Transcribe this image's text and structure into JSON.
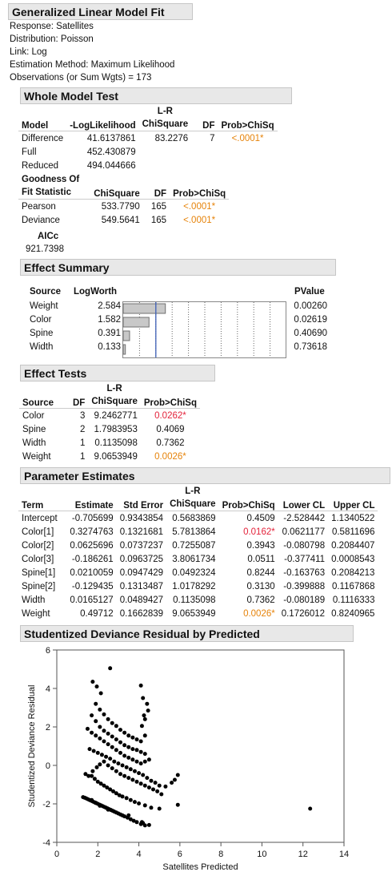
{
  "report": {
    "title": "Generalized Linear Model Fit",
    "info": [
      "Response: Satellites",
      "Distribution: Poisson",
      "Link: Log",
      "Estimation Method: Maximum Likelihood",
      "Observations (or Sum Wgts) = 173"
    ]
  },
  "whole_model": {
    "title": "Whole Model Test",
    "headers": [
      "Model",
      "-LogLikelihood",
      "L-R ChiSquare",
      "DF",
      "Prob>ChiSq"
    ],
    "header_top_lr": "L-R",
    "header_bot_lr": "ChiSquare",
    "rows": [
      {
        "model": "Difference",
        "ll": "41.6137861",
        "chisq": "83.2276",
        "df": "7",
        "p": "<.0001*"
      },
      {
        "model": "Full",
        "ll": "452.430879",
        "chisq": "",
        "df": "",
        "p": ""
      },
      {
        "model": "Reduced",
        "ll": "494.044666",
        "chisq": "",
        "df": "",
        "p": ""
      }
    ]
  },
  "goodness": {
    "h1_top": "Goodness Of",
    "h1_bot": "Fit Statistic",
    "h2": "ChiSquare",
    "h3": "DF",
    "h4": "Prob>ChiSq",
    "rows": [
      {
        "stat": "Pearson",
        "chisq": "533.7790",
        "df": "165",
        "p": "<.0001*"
      },
      {
        "stat": "Deviance",
        "chisq": "549.5641",
        "df": "165",
        "p": "<.0001*"
      }
    ],
    "aicc_label": "AICc",
    "aicc_value": "921.7398"
  },
  "effect_summary": {
    "title": "Effect Summary",
    "h_source": "Source",
    "h_logworth": "LogWorth",
    "h_pvalue": "PValue",
    "rows": [
      {
        "source": "Weight",
        "logworth": "2.584",
        "lw": 2.584,
        "pvalue": "0.00260"
      },
      {
        "source": "Color",
        "logworth": "1.582",
        "lw": 1.582,
        "pvalue": "0.02619"
      },
      {
        "source": "Spine",
        "logworth": "0.391",
        "lw": 0.391,
        "pvalue": "0.40690"
      },
      {
        "source": "Width",
        "logworth": "0.133",
        "lw": 0.133,
        "pvalue": "0.73618"
      }
    ]
  },
  "effect_tests": {
    "title": "Effect Tests",
    "h_source": "Source",
    "h_df": "DF",
    "h_lr_top": "L-R",
    "h_lr_bot": "ChiSquare",
    "h_p": "Prob>ChiSq",
    "rows": [
      {
        "source": "Color",
        "df": "3",
        "chisq": "9.2462771",
        "p": "0.0262*",
        "sig": "r"
      },
      {
        "source": "Spine",
        "df": "2",
        "chisq": "1.7983953",
        "p": "0.4069",
        "sig": ""
      },
      {
        "source": "Width",
        "df": "1",
        "chisq": "0.1135098",
        "p": "0.7362",
        "sig": ""
      },
      {
        "source": "Weight",
        "df": "1",
        "chisq": "9.0653949",
        "p": "0.0026*",
        "sig": "o"
      }
    ]
  },
  "param_estimates": {
    "title": "Parameter Estimates",
    "h_term": "Term",
    "h_est": "Estimate",
    "h_se": "Std Error",
    "h_lr_top": "L-R",
    "h_lr_bot": "ChiSquare",
    "h_p": "Prob>ChiSq",
    "h_lcl": "Lower CL",
    "h_ucl": "Upper CL",
    "rows": [
      {
        "term": "Intercept",
        "est": "-0.705699",
        "se": "0.9343854",
        "chisq": "0.5683869",
        "p": "0.4509",
        "lcl": "-2.528442",
        "ucl": "1.1340522",
        "sig": ""
      },
      {
        "term": "Color[1]",
        "est": "0.3274763",
        "se": "0.1321681",
        "chisq": "5.7813864",
        "p": "0.0162*",
        "lcl": "0.0621177",
        "ucl": "0.5811696",
        "sig": "r"
      },
      {
        "term": "Color[2]",
        "est": "0.0625696",
        "se": "0.0737237",
        "chisq": "0.7255087",
        "p": "0.3943",
        "lcl": "-0.080798",
        "ucl": "0.2084407",
        "sig": ""
      },
      {
        "term": "Color[3]",
        "est": "-0.186261",
        "se": "0.0963725",
        "chisq": "3.8061734",
        "p": "0.0511",
        "lcl": "-0.377411",
        "ucl": "0.0008543",
        "sig": ""
      },
      {
        "term": "Spine[1]",
        "est": "0.0210059",
        "se": "0.0947429",
        "chisq": "0.0492324",
        "p": "0.8244",
        "lcl": "-0.163763",
        "ucl": "0.2084213",
        "sig": ""
      },
      {
        "term": "Spine[2]",
        "est": "-0.129435",
        "se": "0.1313487",
        "chisq": "1.0178292",
        "p": "0.3130",
        "lcl": "-0.399888",
        "ucl": "0.1167868",
        "sig": ""
      },
      {
        "term": "Width",
        "est": "0.0165127",
        "se": "0.0489427",
        "chisq": "0.1135098",
        "p": "0.7362",
        "lcl": "-0.080189",
        "ucl": "0.1116333",
        "sig": ""
      },
      {
        "term": "Weight",
        "est": "0.49712",
        "se": "0.1662839",
        "chisq": "9.0653949",
        "p": "0.0026*",
        "lcl": "0.1726012",
        "ucl": "0.8240965",
        "sig": "o"
      }
    ]
  },
  "residual_plot": {
    "title": "Studentized Deviance Residual by Predicted"
  },
  "chart_data": {
    "type": "scatter",
    "title": "Studentized Deviance Residual by Predicted",
    "xlabel": "Satellites Predicted",
    "ylabel": "Studentized Deviance Residual",
    "xlim": [
      0,
      14
    ],
    "ylim": [
      -4,
      6
    ],
    "xticks": [
      "0",
      "2",
      "4",
      "6",
      "8",
      "10",
      "12",
      "14"
    ],
    "yticks": [
      "-4",
      "-2",
      "0",
      "2",
      "4",
      "6"
    ],
    "grid": false,
    "points": [
      [
        1.28,
        -1.65
      ],
      [
        1.36,
        -1.68
      ],
      [
        1.44,
        -1.72
      ],
      [
        1.52,
        -1.76
      ],
      [
        1.6,
        -1.8
      ],
      [
        1.68,
        -1.84
      ],
      [
        1.76,
        -1.88
      ],
      [
        1.84,
        -1.92
      ],
      [
        1.92,
        -1.96
      ],
      [
        2.0,
        -2.0
      ],
      [
        2.08,
        -2.04
      ],
      [
        2.16,
        -2.08
      ],
      [
        2.24,
        -2.12
      ],
      [
        2.32,
        -2.16
      ],
      [
        2.4,
        -2.2
      ],
      [
        2.48,
        -2.24
      ],
      [
        2.56,
        -2.28
      ],
      [
        2.64,
        -2.32
      ],
      [
        2.72,
        -2.36
      ],
      [
        2.8,
        -2.4
      ],
      [
        2.9,
        -2.45
      ],
      [
        3.0,
        -2.5
      ],
      [
        3.1,
        -2.55
      ],
      [
        3.2,
        -2.6
      ],
      [
        3.3,
        -2.65
      ],
      [
        3.45,
        -2.72
      ],
      [
        3.6,
        -2.8
      ],
      [
        3.75,
        -2.88
      ],
      [
        3.9,
        -2.95
      ],
      [
        4.1,
        -3.05
      ],
      [
        4.3,
        -3.12
      ],
      [
        4.5,
        -3.1
      ],
      [
        4.2,
        -3.0
      ],
      [
        3.5,
        -2.6
      ],
      [
        2.1,
        -2.1
      ],
      [
        1.9,
        -1.95
      ],
      [
        1.7,
        -1.8
      ],
      [
        2.5,
        -2.3
      ],
      [
        4.15,
        -2.95
      ],
      [
        1.7,
        -0.55
      ],
      [
        1.85,
        -0.7
      ],
      [
        2.0,
        -0.85
      ],
      [
        2.15,
        -0.95
      ],
      [
        2.3,
        -1.05
      ],
      [
        2.45,
        -1.15
      ],
      [
        2.6,
        -1.25
      ],
      [
        2.75,
        -1.35
      ],
      [
        2.9,
        -1.45
      ],
      [
        3.05,
        -1.55
      ],
      [
        3.2,
        -1.62
      ],
      [
        3.4,
        -1.7
      ],
      [
        3.6,
        -1.8
      ],
      [
        3.8,
        -1.9
      ],
      [
        4.0,
        -1.98
      ],
      [
        4.3,
        -2.08
      ],
      [
        4.6,
        -2.2
      ],
      [
        5.0,
        -2.25
      ],
      [
        5.9,
        -2.05
      ],
      [
        1.4,
        -0.45
      ],
      [
        1.55,
        -0.55
      ],
      [
        1.75,
        -0.3
      ],
      [
        1.95,
        -0.1
      ],
      [
        2.1,
        0.05
      ],
      [
        2.3,
        0.2
      ],
      [
        2.5,
        0.0
      ],
      [
        2.7,
        -0.15
      ],
      [
        2.9,
        -0.3
      ],
      [
        3.1,
        -0.45
      ],
      [
        3.3,
        -0.55
      ],
      [
        3.5,
        -0.65
      ],
      [
        3.7,
        -0.75
      ],
      [
        3.9,
        -0.85
      ],
      [
        4.1,
        -0.95
      ],
      [
        4.3,
        -1.05
      ],
      [
        4.5,
        -1.15
      ],
      [
        4.7,
        -1.25
      ],
      [
        4.9,
        -1.35
      ],
      [
        5.1,
        -1.5
      ],
      [
        1.6,
        0.85
      ],
      [
        1.8,
        0.75
      ],
      [
        2.0,
        0.65
      ],
      [
        2.2,
        0.55
      ],
      [
        2.4,
        0.45
      ],
      [
        2.6,
        0.35
      ],
      [
        2.8,
        0.2
      ],
      [
        3.0,
        0.1
      ],
      [
        3.2,
        0.0
      ],
      [
        3.4,
        -0.1
      ],
      [
        3.6,
        -0.2
      ],
      [
        3.8,
        -0.3
      ],
      [
        4.0,
        -0.4
      ],
      [
        4.2,
        -0.5
      ],
      [
        4.4,
        -0.65
      ],
      [
        4.6,
        -0.8
      ],
      [
        4.8,
        -0.9
      ],
      [
        5.0,
        -1.05
      ],
      [
        5.3,
        -1.1
      ],
      [
        5.6,
        -0.9
      ],
      [
        5.9,
        -0.5
      ],
      [
        5.75,
        -0.75
      ],
      [
        1.5,
        1.9
      ],
      [
        1.7,
        1.7
      ],
      [
        1.9,
        1.55
      ],
      [
        2.1,
        1.4
      ],
      [
        2.3,
        1.25
      ],
      [
        2.5,
        1.1
      ],
      [
        2.7,
        0.95
      ],
      [
        2.9,
        0.8
      ],
      [
        3.1,
        0.65
      ],
      [
        3.3,
        0.5
      ],
      [
        3.5,
        0.4
      ],
      [
        3.7,
        0.3
      ],
      [
        3.9,
        0.2
      ],
      [
        4.1,
        0.1
      ],
      [
        4.3,
        0.2
      ],
      [
        4.5,
        0.3
      ],
      [
        1.7,
        2.6
      ],
      [
        1.9,
        2.3
      ],
      [
        2.1,
        2.0
      ],
      [
        2.3,
        1.8
      ],
      [
        2.5,
        1.65
      ],
      [
        2.7,
        1.5
      ],
      [
        2.9,
        1.35
      ],
      [
        3.1,
        1.2
      ],
      [
        3.3,
        1.05
      ],
      [
        3.5,
        0.95
      ],
      [
        3.7,
        0.85
      ],
      [
        3.9,
        0.8
      ],
      [
        4.1,
        0.7
      ],
      [
        4.3,
        0.6
      ],
      [
        1.9,
        3.2
      ],
      [
        2.1,
        2.9
      ],
      [
        2.3,
        2.65
      ],
      [
        2.5,
        2.4
      ],
      [
        2.7,
        2.2
      ],
      [
        2.9,
        2.05
      ],
      [
        3.1,
        1.85
      ],
      [
        3.3,
        1.7
      ],
      [
        3.5,
        1.55
      ],
      [
        3.7,
        1.45
      ],
      [
        3.9,
        1.35
      ],
      [
        4.1,
        1.25
      ],
      [
        4.3,
        1.55
      ],
      [
        4.15,
        2.05
      ],
      [
        4.25,
        2.6
      ],
      [
        4.4,
        3.2
      ],
      [
        1.75,
        4.35
      ],
      [
        1.95,
        4.1
      ],
      [
        2.15,
        3.75
      ],
      [
        2.6,
        5.05
      ],
      [
        4.1,
        4.15
      ],
      [
        4.2,
        3.5
      ],
      [
        4.45,
        2.85
      ],
      [
        4.3,
        2.4
      ],
      [
        12.35,
        -2.25
      ]
    ]
  }
}
